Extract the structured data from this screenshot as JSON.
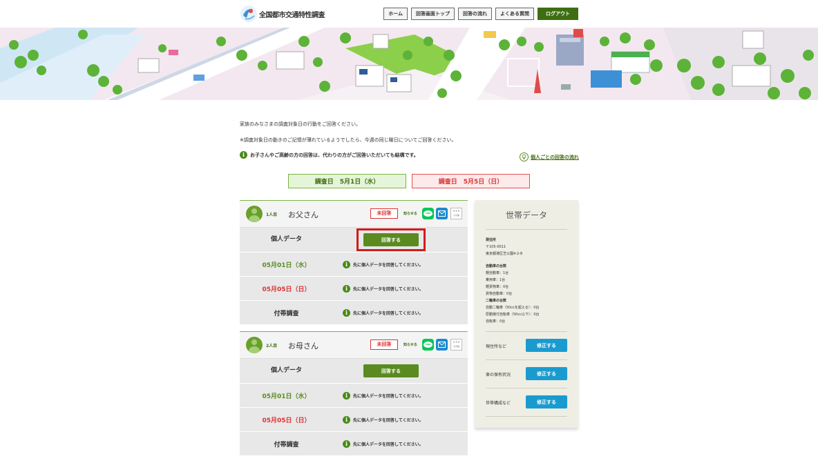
{
  "header": {
    "site_title": "全国都市交通特性調査",
    "nav": [
      "ホーム",
      "回答画面トップ",
      "回答の流れ",
      "よくある質問"
    ],
    "logout": "ログアウト"
  },
  "intro": {
    "line1": "家族のみなさまの調査対象日の行動をご回答ください。",
    "line2": "※調査対象日の動きのご記憶が薄れているようでしたら、今週の同じ曜日についてご回答ください。",
    "line3": "お子さんやご高齢の方の回答は、代わりの方がご回答いただいても結構です。",
    "flow_link": "個人ごとの回答の流れ"
  },
  "dates": {
    "day1": "調査日　5月1日（水）",
    "day2": "調査日　5月5日（日）"
  },
  "persons": [
    {
      "ordinal": "1人目",
      "name": "お父さん",
      "status": "未回答",
      "notify": "知らせる",
      "other": "その他",
      "rows": {
        "personal_label": "個人データ",
        "answer_btn": "回答する",
        "d1": "05月01日（水）",
        "d2": "05月05日（日）",
        "household": "付帯調査",
        "msg": "先に個人データを回答してください。"
      }
    },
    {
      "ordinal": "2人目",
      "name": "お母さん",
      "status": "未回答",
      "notify": "知らせる",
      "other": "その他",
      "rows": {
        "personal_label": "個人データ",
        "answer_btn": "回答する",
        "d1": "05月01日（水）",
        "d2": "05月05日（日）",
        "household": "付帯調査",
        "msg": "先に個人データを回答してください。"
      }
    }
  ],
  "household": {
    "title": "世帯データ",
    "address_h": "現住所",
    "postal": "〒105-0011",
    "address": "東京都港区芝公園4-2-8",
    "cars_h": "自動車の台数",
    "cars": [
      "軽自動車：1台",
      "乗用車：1台",
      "軽貨物車：0台",
      "貨物自動車：0台"
    ],
    "bikes_h": "二輪車の台数",
    "bikes": [
      "自動二輪車（50ccを超える）：0台",
      "原動機付自転車（50cc以下）：0台",
      "自転車：0台"
    ],
    "sections": [
      "現住所など",
      "車の保有状況",
      "世帯構成など"
    ],
    "fix_btn": "修正する"
  },
  "colors": {
    "accent_green": "#5a8a20",
    "alert_red": "#d33333",
    "fix_blue": "#1a9bd0"
  }
}
